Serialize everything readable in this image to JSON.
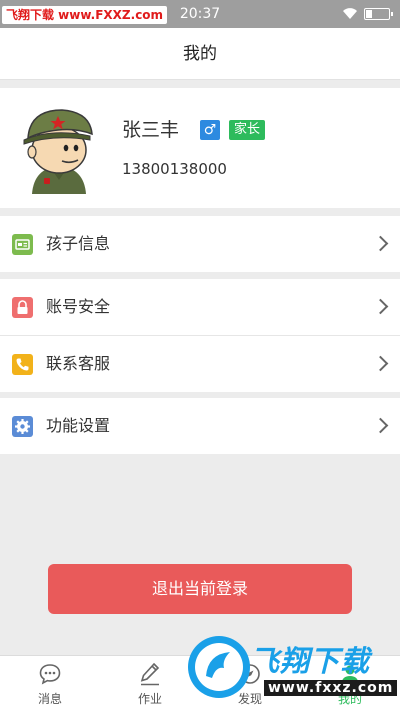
{
  "status_bar": {
    "watermark": "飞翔下载 www.FXXZ.com",
    "time": "20:37"
  },
  "header": {
    "title": "我的"
  },
  "profile": {
    "name": "张三丰",
    "gender_symbol": "♂",
    "role": "家长",
    "phone": "13800138000"
  },
  "menu": [
    {
      "label": "孩子信息",
      "icon": "id-card-icon",
      "color": "#7dbb4e"
    },
    {
      "label": "账号安全",
      "icon": "lock-icon",
      "color": "#ef6f6f"
    },
    {
      "label": "联系客服",
      "icon": "phone-icon",
      "color": "#f2b21a"
    },
    {
      "label": "功能设置",
      "icon": "gear-icon",
      "color": "#5b8cd6"
    }
  ],
  "logout_label": "退出当前登录",
  "tabs": [
    {
      "label": "消息",
      "icon": "chat-bubble-icon"
    },
    {
      "label": "作业",
      "icon": "pencil-icon"
    },
    {
      "label": "发现",
      "icon": "compass-icon"
    },
    {
      "label": "我的",
      "icon": "profile-icon",
      "active": true
    }
  ],
  "watermark_bottom": {
    "text": "飞翔下载",
    "url": "www.fxxz.com"
  },
  "colors": {
    "accent_green": "#2dbb5c",
    "logout_red": "#e95a5a",
    "gender_blue": "#2d8ae0"
  }
}
